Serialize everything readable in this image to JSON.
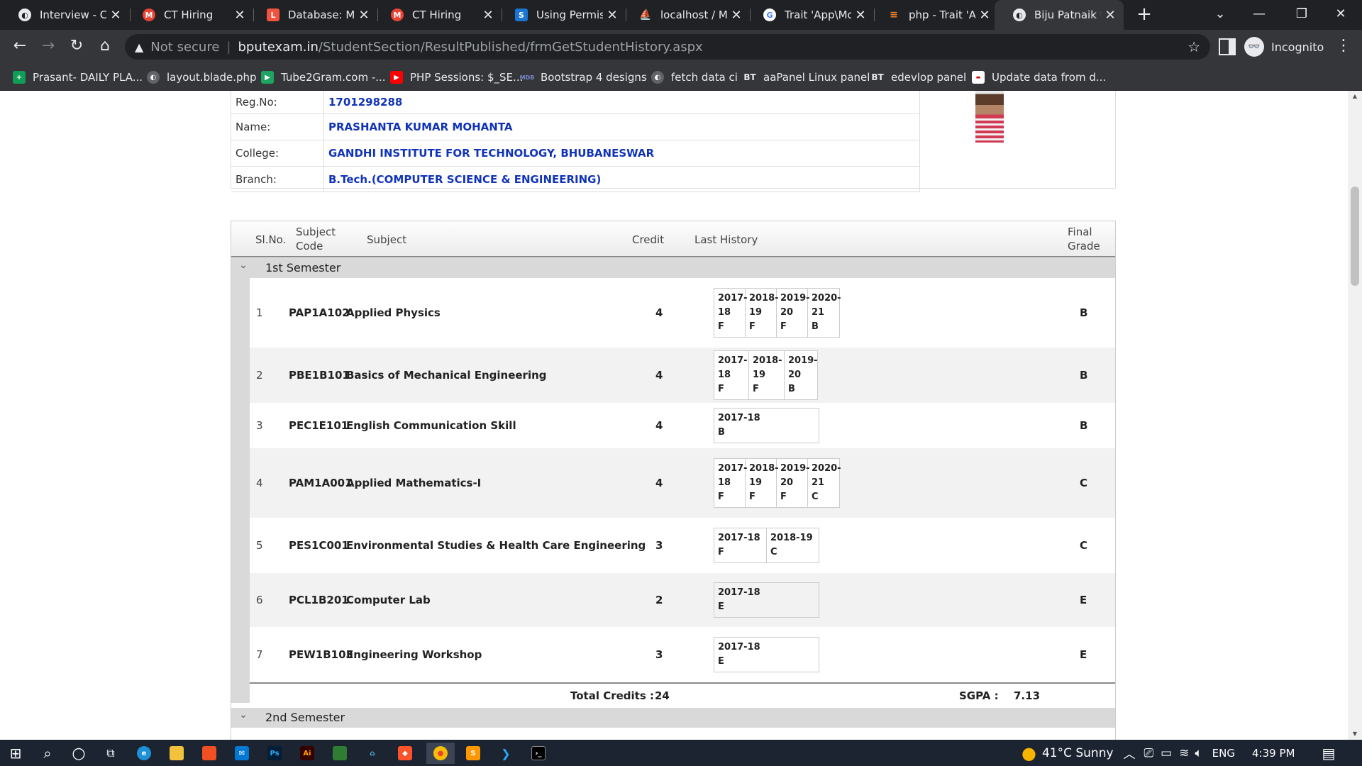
{
  "browser": {
    "tabs": [
      {
        "title": "Interview - CT",
        "icon": "globe-icon",
        "color": "#e8eaed"
      },
      {
        "title": "CT Hiring",
        "icon": "gmail-icon",
        "color": "#ea4335"
      },
      {
        "title": "Database: Mig",
        "icon": "laravel-icon",
        "color": "#f05340"
      },
      {
        "title": "CT Hiring",
        "icon": "gmail-icon",
        "color": "#ea4335"
      },
      {
        "title": "Using Permiss",
        "icon": "s-icon",
        "color": "#1976d2"
      },
      {
        "title": "localhost / My",
        "icon": "phpmyadmin-icon",
        "color": "#f4a62a"
      },
      {
        "title": "Trait 'App\\Mo",
        "icon": "google-icon",
        "color": "#4285f4"
      },
      {
        "title": "php - Trait 'Ap",
        "icon": "stackoverflow-icon",
        "color": "#f48024"
      },
      {
        "title": "Biju Patnaik U",
        "icon": "globe-icon",
        "color": "#e8eaed",
        "active": true
      }
    ],
    "address": {
      "warning": "Not secure",
      "domain": "bputexam.in",
      "path": "/StudentSection/ResultPublished/frmGetStudentHistory.aspx"
    },
    "profile_label": "Incognito",
    "bookmarks": [
      {
        "label": "Prasant- DAILY PLA...",
        "icon": "plus-sheet-icon",
        "color": "#0f9d58"
      },
      {
        "label": "layout.blade.php",
        "icon": "globe-icon",
        "color": "#9aa0a6"
      },
      {
        "label": "Tube2Gram.com -...",
        "icon": "tube2gram-icon",
        "color": "#1ea362"
      },
      {
        "label": "PHP Sessions: $_SE...",
        "icon": "youtube-icon",
        "color": "#ff0000"
      },
      {
        "label": "Bootstrap 4 designs",
        "icon": "mdb-icon",
        "color": "#3f51b5"
      },
      {
        "label": "fetch data ci",
        "icon": "globe-icon",
        "color": "#9aa0a6"
      },
      {
        "label": "aaPanel Linux panel",
        "icon": "bt-icon",
        "color": "#35363a"
      },
      {
        "label": "edevlop panel",
        "icon": "bt-icon",
        "color": "#35363a"
      },
      {
        "label": "Update data from d...",
        "icon": "page-icon",
        "color": "#ffffff"
      }
    ]
  },
  "student": {
    "fields": [
      {
        "label": "Reg.No:",
        "value": "1701298288"
      },
      {
        "label": "Name:",
        "value": "PRASHANTA KUMAR MOHANTA"
      },
      {
        "label": "College:",
        "value": "GANDHI INSTITUTE FOR TECHNOLOGY, BHUBANESWAR"
      },
      {
        "label": "Branch:",
        "value": "B.Tech.(COMPUTER SCIENCE & ENGINEERING)"
      }
    ]
  },
  "grid": {
    "headers": {
      "slno": "Sl.No.",
      "code": "Subject\nCode",
      "subject": "Subject",
      "credit": "Credit",
      "history": "Last History",
      "grade": "Final\nGrade"
    },
    "semesters": [
      {
        "label": "1st Semester",
        "rows": [
          {
            "sl": "1",
            "code": "PAP1A102",
            "subject": "Applied Physics",
            "credit": "4",
            "history": [
              {
                "year": "2017-\n18",
                "grade": "F"
              },
              {
                "year": "2018-\n19",
                "grade": "F"
              },
              {
                "year": "2019-\n20",
                "grade": "F"
              },
              {
                "year": "2020-\n21",
                "grade": "B"
              }
            ],
            "grade": "B"
          },
          {
            "sl": "2",
            "code": "PBE1B101",
            "subject": "Basics of Mechanical Engineering",
            "credit": "4",
            "history": [
              {
                "year": "2017-\n18",
                "grade": "F"
              },
              {
                "year": "2018-\n19",
                "grade": "F"
              },
              {
                "year": "2019-\n20",
                "grade": "B"
              }
            ],
            "grade": "B"
          },
          {
            "sl": "3",
            "code": "PEC1E101",
            "subject": "English Communication Skill",
            "credit": "4",
            "history": [
              {
                "year": "2017-18",
                "grade": "B"
              }
            ],
            "grade": "B"
          },
          {
            "sl": "4",
            "code": "PAM1A001",
            "subject": "Applied Mathematics-I",
            "credit": "4",
            "history": [
              {
                "year": "2017-\n18",
                "grade": "F"
              },
              {
                "year": "2018-\n19",
                "grade": "F"
              },
              {
                "year": "2019-\n20",
                "grade": "F"
              },
              {
                "year": "2020-\n21",
                "grade": "C"
              }
            ],
            "grade": "C"
          },
          {
            "sl": "5",
            "code": "PES1C001",
            "subject": "Environmental Studies & Health Care Engineering",
            "credit": "3",
            "history": [
              {
                "year": "2017-18",
                "grade": "F"
              },
              {
                "year": "2018-19",
                "grade": "C"
              }
            ],
            "grade": "C"
          },
          {
            "sl": "6",
            "code": "PCL1B201",
            "subject": "Computer Lab",
            "credit": "2",
            "history": [
              {
                "year": "2017-18",
                "grade": "E"
              }
            ],
            "grade": "E"
          },
          {
            "sl": "7",
            "code": "PEW1B103",
            "subject": "Engineering Workshop",
            "credit": "3",
            "history": [
              {
                "year": "2017-18",
                "grade": "E"
              }
            ],
            "grade": "E"
          }
        ],
        "total_credits_label": "Total Credits :",
        "total_credits": "24",
        "sgpa_label": "SGPA :",
        "sgpa": "7.13"
      },
      {
        "label": "2nd Semester"
      }
    ]
  },
  "taskbar": {
    "weather": "41°C  Sunny",
    "lang": "ENG",
    "time": "4:39 PM"
  }
}
